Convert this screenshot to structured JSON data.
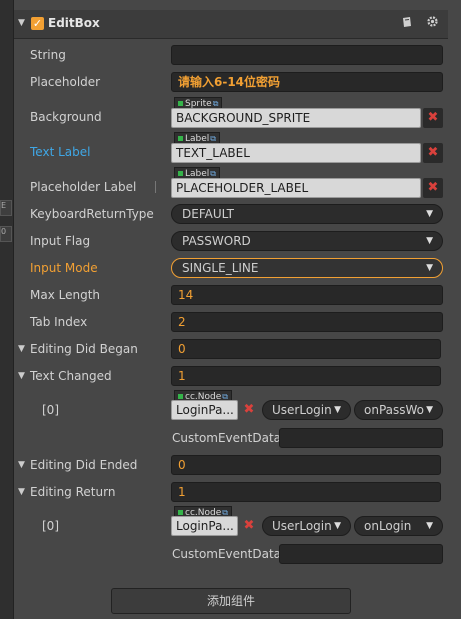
{
  "component": {
    "title": "EditBox"
  },
  "header_icons": [
    "book-icon",
    "gear-icon"
  ],
  "properties": {
    "string": {
      "label": "String",
      "value": ""
    },
    "placeholder": {
      "label": "Placeholder",
      "value": "请输入6-14位密码"
    },
    "background": {
      "label": "Background",
      "type_tag": "Sprite",
      "value": "BACKGROUND_SPRITE"
    },
    "text_label": {
      "label": "Text Label",
      "type_tag": "Label",
      "value": "TEXT_LABEL"
    },
    "placeholder_label": {
      "label": "Placeholder Label",
      "type_tag": "Label",
      "value": "PLACEHOLDER_LABEL"
    },
    "keyboard_return_type": {
      "label": "KeyboardReturnType",
      "value": "DEFAULT"
    },
    "input_flag": {
      "label": "Input Flag",
      "value": "PASSWORD"
    },
    "input_mode": {
      "label": "Input Mode",
      "value": "SINGLE_LINE"
    },
    "max_length": {
      "label": "Max Length",
      "value": "14"
    },
    "tab_index": {
      "label": "Tab Index",
      "value": "2"
    }
  },
  "events": {
    "editing_did_began": {
      "label": "Editing Did Began",
      "count": "0"
    },
    "text_changed": {
      "label": "Text Changed",
      "count": "1",
      "item": {
        "index": "[0]",
        "type_tag": "cc.Node",
        "node": "LoginPa...",
        "component": "UserLogin",
        "handler": "onPassWo",
        "custom_label": "CustomEventData",
        "custom_value": ""
      }
    },
    "editing_did_ended": {
      "label": "Editing Did Ended",
      "count": "0"
    },
    "editing_return": {
      "label": "Editing Return",
      "count": "1",
      "item": {
        "index": "[0]",
        "type_tag": "cc.Node",
        "node": "LoginPa...",
        "component": "UserLogin",
        "handler": "onLogin",
        "custom_label": "CustomEventData",
        "custom_value": ""
      }
    }
  },
  "add_component_button": "添加组件",
  "left_strip": [
    "E",
    "0"
  ],
  "colors": {
    "accent": "#f2a033",
    "link": "#3fa7e6",
    "clear": "#d9413c",
    "bg": "#474747",
    "field": "#282828"
  }
}
